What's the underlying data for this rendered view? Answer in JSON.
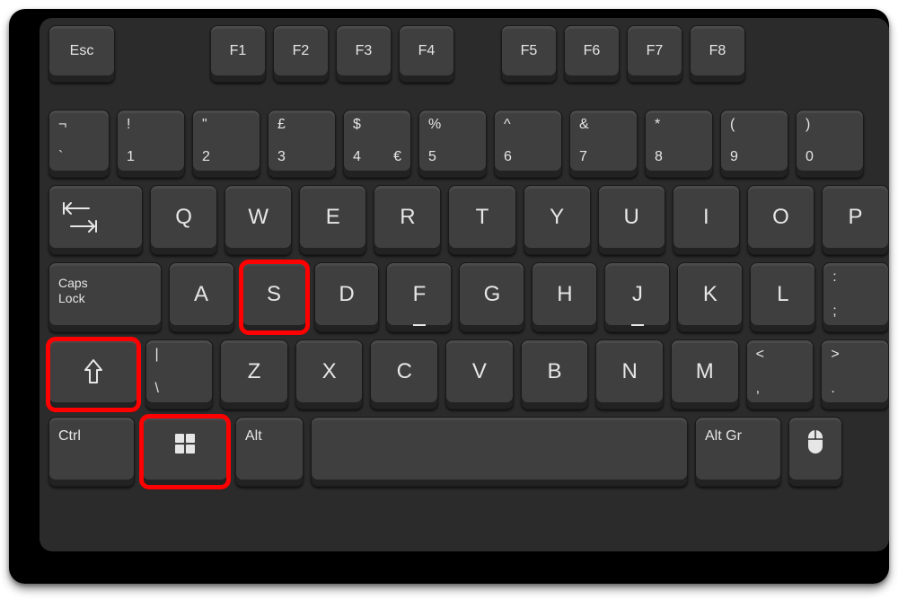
{
  "keyboard": {
    "func_row": {
      "esc": "Esc",
      "keys": [
        "F1",
        "F2",
        "F3",
        "F4",
        "F5",
        "F6",
        "F7",
        "F8"
      ]
    },
    "num_row": [
      {
        "top": "¬",
        "bottom": "`",
        "right": ""
      },
      {
        "top": "!",
        "bottom": "1",
        "right": ""
      },
      {
        "top": "\"",
        "bottom": "2",
        "right": ""
      },
      {
        "top": "£",
        "bottom": "3",
        "right": ""
      },
      {
        "top": "$",
        "bottom": "4",
        "right": "€"
      },
      {
        "top": "%",
        "bottom": "5",
        "right": ""
      },
      {
        "top": "^",
        "bottom": "6",
        "right": ""
      },
      {
        "top": "&",
        "bottom": "7",
        "right": ""
      },
      {
        "top": "*",
        "bottom": "8",
        "right": ""
      },
      {
        "top": "(",
        "bottom": "9",
        "right": ""
      },
      {
        "top": ")",
        "bottom": "0",
        "right": ""
      }
    ],
    "qwerty_row": {
      "letters": [
        "Q",
        "W",
        "E",
        "R",
        "T",
        "Y",
        "U",
        "I",
        "O",
        "P"
      ]
    },
    "asdf_row": {
      "caps": "Caps\nLock",
      "letters": [
        "A",
        "S",
        "D",
        "F",
        "G",
        "H",
        "J",
        "K",
        "L"
      ],
      "semi": {
        "top": ":",
        "bottom": ";"
      }
    },
    "zxcv_row": {
      "backslash": {
        "top": "|",
        "bottom": "\\"
      },
      "letters": [
        "Z",
        "X",
        "C",
        "V",
        "B",
        "N",
        "M"
      ],
      "comma": {
        "top": "<",
        "bottom": ","
      },
      "period": {
        "top": ">",
        "bottom": "."
      }
    },
    "mod_row": {
      "ctrl": "Ctrl",
      "alt": "Alt",
      "altgr": "Alt Gr"
    }
  },
  "highlighted_keys": [
    "shift",
    "windows",
    "s"
  ],
  "colors": {
    "highlight": "#ff0000",
    "key": "#3f3f3f",
    "board": "#2b2b2b"
  }
}
